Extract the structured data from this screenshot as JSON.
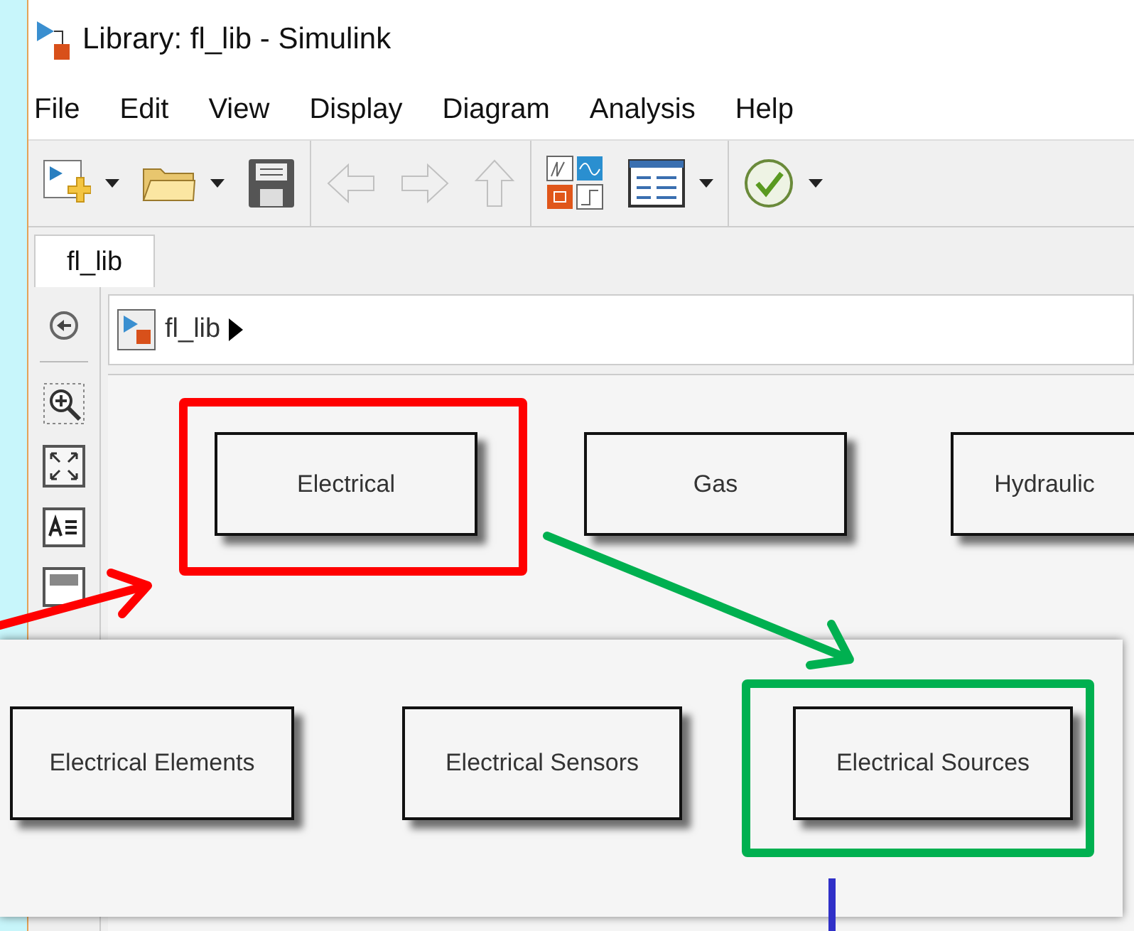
{
  "window": {
    "title": "Library: fl_lib - Simulink"
  },
  "menu": [
    {
      "label": "File"
    },
    {
      "label": "Edit"
    },
    {
      "label": "View"
    },
    {
      "label": "Display"
    },
    {
      "label": "Diagram"
    },
    {
      "label": "Analysis"
    },
    {
      "label": "Help"
    }
  ],
  "toolbar_groups": [
    {
      "items": [
        {
          "kind": "new-model",
          "dropdown": true,
          "disabled": false
        },
        {
          "kind": "open",
          "dropdown": true,
          "disabled": false
        },
        {
          "kind": "save",
          "dropdown": false,
          "disabled": false
        }
      ]
    },
    {
      "items": [
        {
          "kind": "back",
          "dropdown": false,
          "disabled": true
        },
        {
          "kind": "forward",
          "dropdown": false,
          "disabled": true
        },
        {
          "kind": "up",
          "dropdown": false,
          "disabled": true
        }
      ]
    },
    {
      "items": [
        {
          "kind": "library",
          "dropdown": false,
          "disabled": false
        },
        {
          "kind": "explorer",
          "dropdown": true,
          "disabled": false
        }
      ]
    },
    {
      "items": [
        {
          "kind": "check",
          "dropdown": true,
          "disabled": false
        }
      ]
    }
  ],
  "tabs": [
    {
      "label": "fl_lib",
      "selected": true
    }
  ],
  "breadcrumb": {
    "label": "fl_lib"
  },
  "library_blocks": [
    {
      "label": "Electrical",
      "highlighted": true
    },
    {
      "label": "Gas",
      "highlighted": false
    },
    {
      "label": "Hydraulic",
      "highlighted": false
    }
  ],
  "sublibrary_blocks": [
    {
      "label": "Electrical Elements",
      "highlighted": false
    },
    {
      "label": "Electrical Sensors",
      "highlighted": false
    },
    {
      "label": "Electrical Sources",
      "highlighted": true
    }
  ]
}
